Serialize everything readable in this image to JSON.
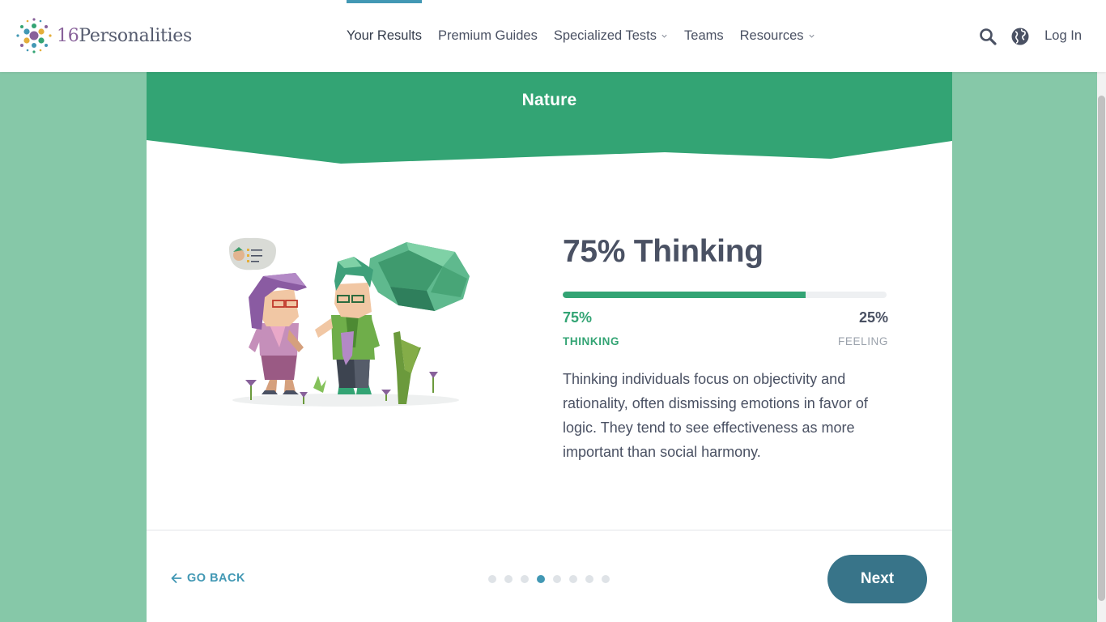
{
  "header": {
    "logo_text_num": "16",
    "logo_text_word": "Personalities",
    "nav": [
      {
        "label": "Your Results",
        "active": true,
        "dropdown": false
      },
      {
        "label": "Premium Guides",
        "active": false,
        "dropdown": false
      },
      {
        "label": "Specialized Tests",
        "active": false,
        "dropdown": true
      },
      {
        "label": "Teams",
        "active": false,
        "dropdown": false
      },
      {
        "label": "Resources",
        "active": false,
        "dropdown": true
      }
    ],
    "search_icon": "search-icon",
    "language_icon": "globe-icon",
    "login_label": "Log In"
  },
  "section": {
    "title": "Nature"
  },
  "result": {
    "title": "75% Thinking",
    "left_percent": "75%",
    "left_trait": "THINKING",
    "right_percent": "25%",
    "right_trait": "FEELING",
    "fill_fraction": 0.75,
    "description": "Thinking individuals focus on objectivity and rationality, often dismissing emotions in favor of logic. They tend to see effectiveness as more important than social harmony."
  },
  "footer": {
    "go_back_label": "GO BACK",
    "next_label": "Next",
    "steps_total": 8,
    "current_step": 4
  },
  "colors": {
    "accent_green": "#33a474",
    "accent_blue": "#4298b4",
    "next_button": "#387489",
    "page_background": "#86c8a8"
  }
}
